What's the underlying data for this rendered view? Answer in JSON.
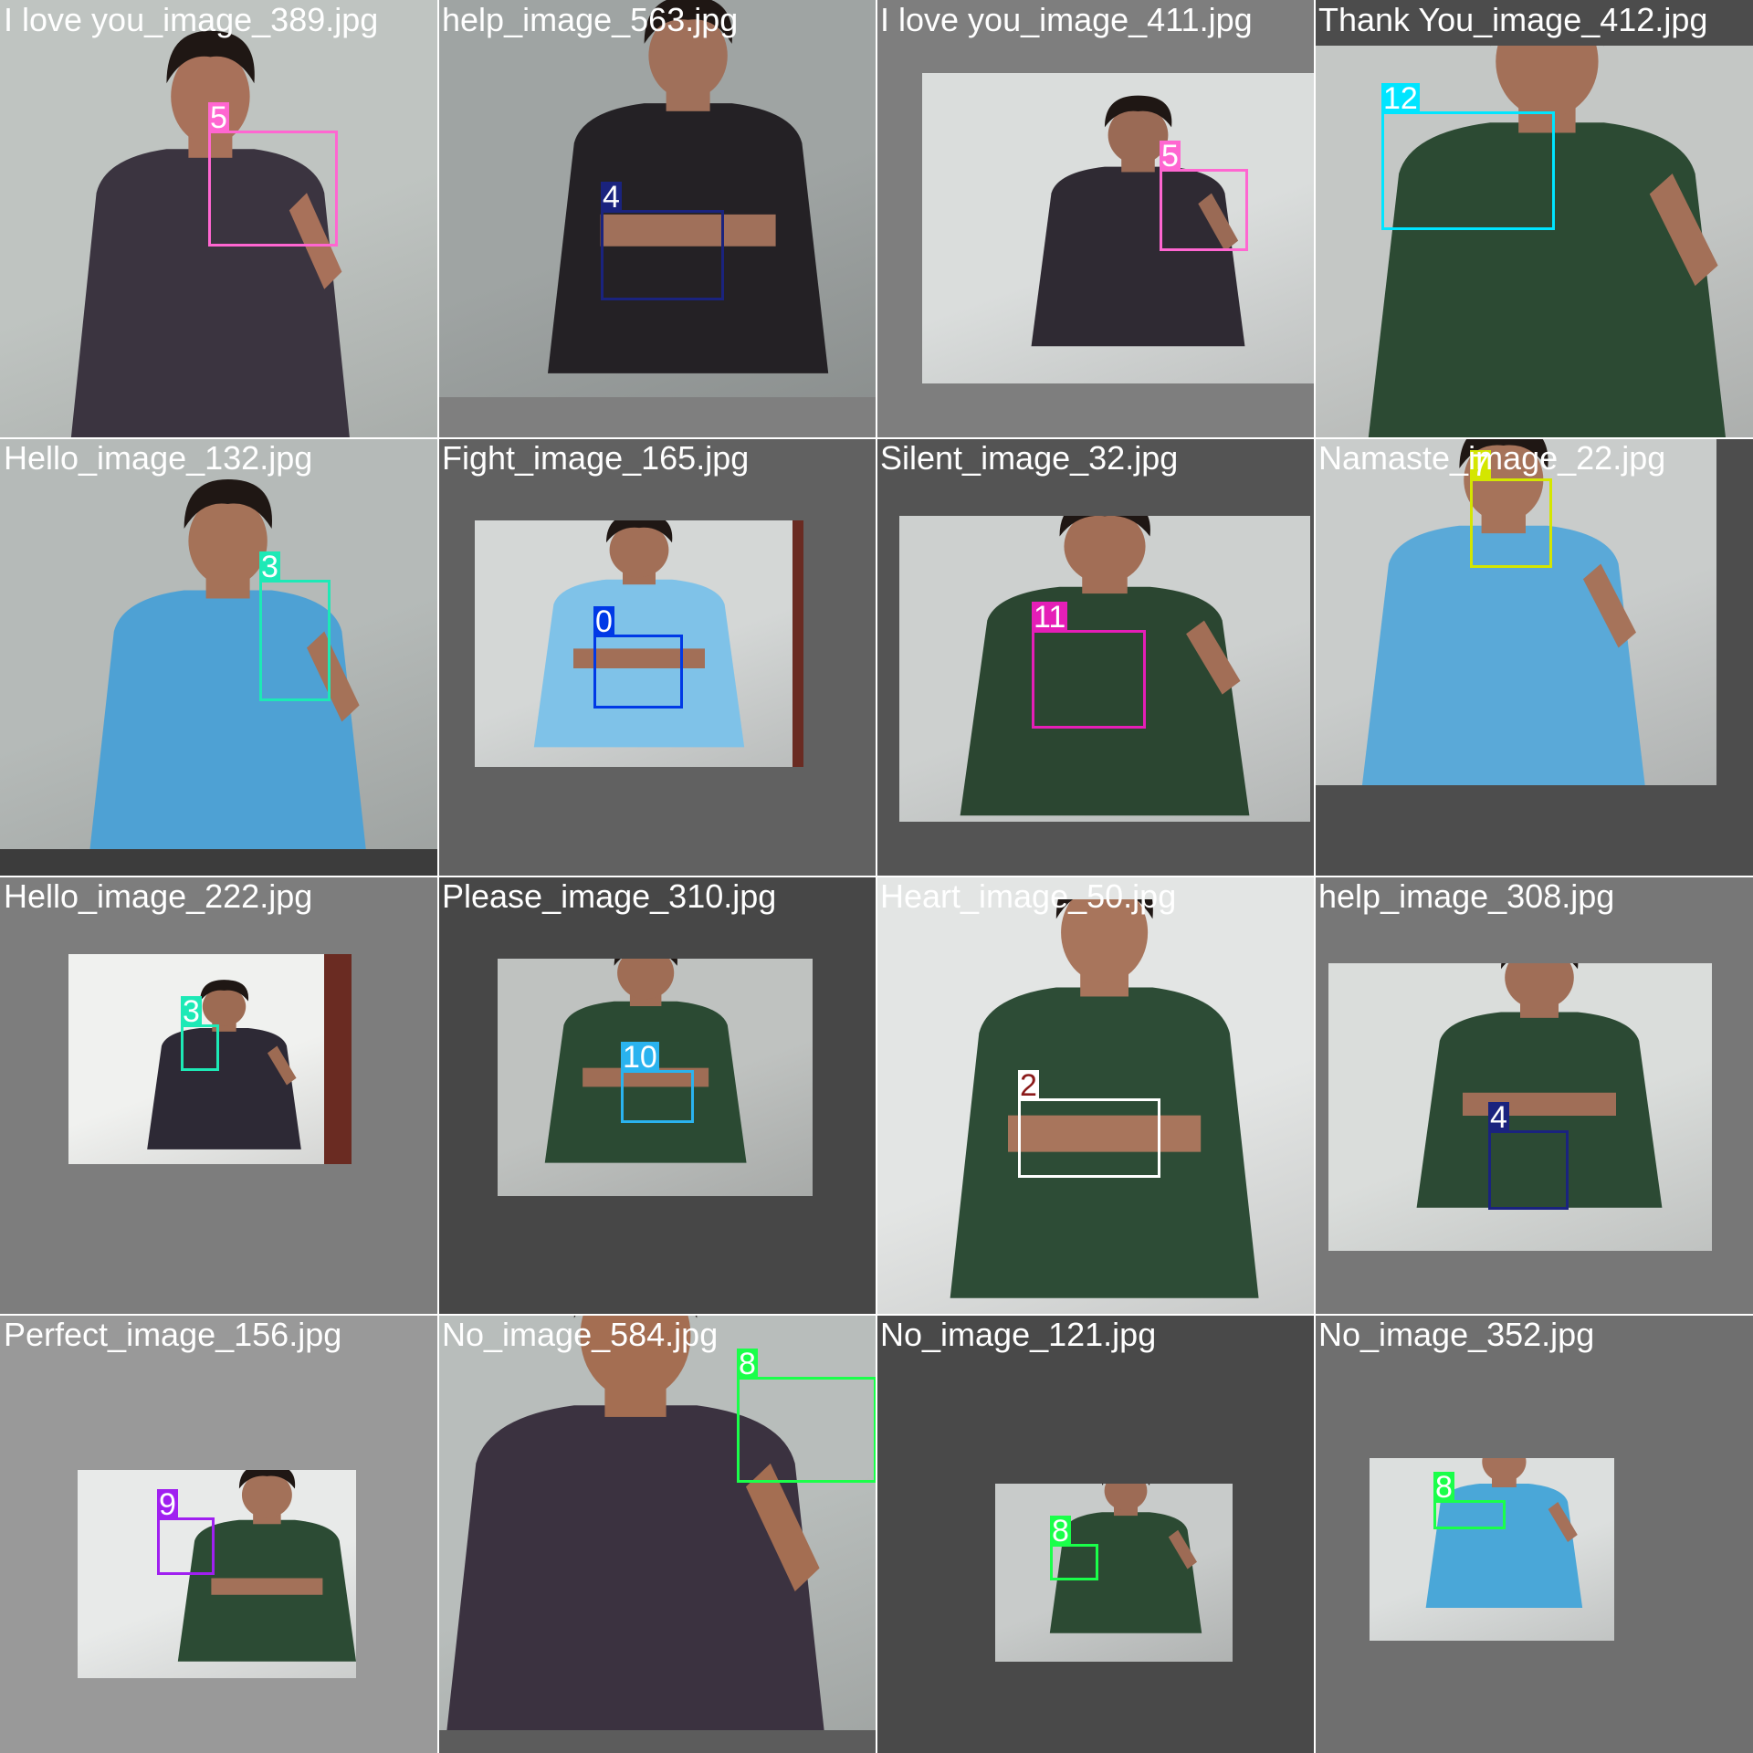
{
  "grid": {
    "cells": [
      {
        "filename": "I love you_image_389.jpg",
        "cell_bg": "#c2c6c2",
        "wall": "#bfc4c1",
        "shirt": "#3b3440",
        "skin": "#a8715a",
        "pose": "ily",
        "label": {
          "id": "5",
          "color": "#ff66d1"
        }
      },
      {
        "filename": "help_image_563.jpg",
        "cell_bg": "#7f7f7f",
        "wall": "#9fa4a3",
        "shirt": "#242125",
        "skin": "#a0705a",
        "pose": "help",
        "label": {
          "id": "4",
          "color": "#1a237e"
        }
      },
      {
        "filename": "I love you_image_411.jpg",
        "cell_bg": "#7e7e7e",
        "wall": "#dadddc",
        "shirt": "#2f2a33",
        "skin": "#9a6a55",
        "pose": "ily",
        "label": {
          "id": "5",
          "color": "#ff66d1"
        }
      },
      {
        "filename": "Thank You_image_412.jpg",
        "cell_bg": "#4c4c4c",
        "wall": "#c4c7c5",
        "shirt": "#2c4a33",
        "skin": "#a37058",
        "pose": "thanks",
        "label": {
          "id": "12",
          "color": "#00e5ff"
        }
      },
      {
        "filename": "Hello_image_132.jpg",
        "cell_bg": "#3c3c3c",
        "wall": "#b5bab8",
        "shirt": "#4ea1d4",
        "skin": "#a57258",
        "pose": "hello",
        "label": {
          "id": "3",
          "color": "#1de9b6"
        }
      },
      {
        "filename": "Fight_image_165.jpg",
        "cell_bg": "#616161",
        "wall": "#d4d7d6",
        "shirt": "#7fc2e8",
        "skin": "#a26f57",
        "pose": "fight",
        "label": {
          "id": "0",
          "color": "#0039e6"
        }
      },
      {
        "filename": "Silent_image_32.jpg",
        "cell_bg": "#545454",
        "wall": "#cdd0cf",
        "shirt": "#2b4631",
        "skin": "#a26e56",
        "pose": "silent",
        "label": {
          "id": "11",
          "color": "#e51eb7"
        }
      },
      {
        "filename": "Namaste_image_22.jpg",
        "cell_bg": "#4d4d4d",
        "wall": "#c9cccb",
        "shirt": "#5aa9d8",
        "skin": "#a6735a",
        "pose": "namaste",
        "label": {
          "id": "7",
          "color": "#d4e600"
        }
      },
      {
        "filename": "Hello_image_222.jpg",
        "cell_bg": "#7d7d7d",
        "wall": "#f0f1ef",
        "shirt": "#2d2935",
        "skin": "#9d6b53",
        "pose": "hello",
        "label": {
          "id": "3",
          "color": "#1de9b6"
        }
      },
      {
        "filename": "Please_image_310.jpg",
        "cell_bg": "#474747",
        "wall": "#bfc2c0",
        "shirt": "#2b4a33",
        "skin": "#9f6d55",
        "pose": "please",
        "label": {
          "id": "10",
          "color": "#2ab3ef"
        }
      },
      {
        "filename": "Heart_image_50.jpg",
        "cell_bg": "#e3e5e4",
        "wall": "#e3e5e4",
        "shirt": "#2d4c36",
        "skin": "#a8755c",
        "pose": "heart",
        "label": {
          "id": "2",
          "color": "#ffffff",
          "tag_text": "#8b1a1a"
        }
      },
      {
        "filename": "help_image_308.jpg",
        "cell_bg": "#777777",
        "wall": "#dadddb",
        "shirt": "#2c4a34",
        "skin": "#a06e57",
        "pose": "help",
        "label": {
          "id": "4",
          "color": "#1a237e"
        }
      },
      {
        "filename": "Perfect_image_156.jpg",
        "cell_bg": "#999999",
        "wall": "#e8eae9",
        "shirt": "#2c4b34",
        "skin": "#a37159",
        "pose": "perfect",
        "label": {
          "id": "9",
          "color": "#a020f0"
        }
      },
      {
        "filename": "No_image_584.jpg",
        "cell_bg": "#5c5c5c",
        "wall": "#b8bdbb",
        "shirt": "#3b3240",
        "skin": "#a46e52",
        "pose": "no",
        "label": {
          "id": "8",
          "color": "#1aff4a"
        }
      },
      {
        "filename": "No_image_121.jpg",
        "cell_bg": "#494949",
        "wall": "#c8cbca",
        "shirt": "#2c4a33",
        "skin": "#9d6b55",
        "pose": "no",
        "label": {
          "id": "8",
          "color": "#1aff4a"
        }
      },
      {
        "filename": "No_image_352.jpg",
        "cell_bg": "#6f6f6f",
        "wall": "#dcdfde",
        "shirt": "#4aa7d8",
        "skin": "#a5715a",
        "pose": "no",
        "label": {
          "id": "8",
          "color": "#1aff4a"
        }
      }
    ]
  }
}
